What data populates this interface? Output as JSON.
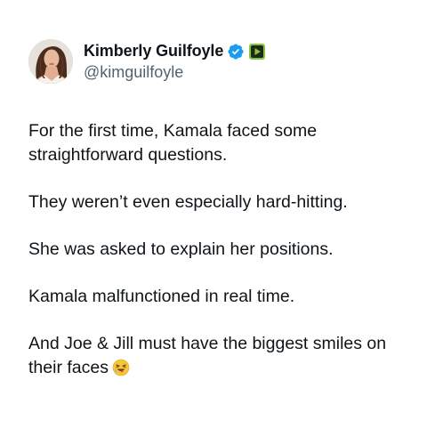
{
  "author": {
    "display_name": "Kimberly Guilfoyle",
    "handle": "@kimguilfoyle",
    "verified_icon": "verified-badge-icon",
    "extra_badge_icon": "rumble-play-icon",
    "verified_color": "#1d9bf0",
    "extra_badge_color": "#85c742"
  },
  "tweet": {
    "paragraphs": [
      "For the first time, Kamala faced some straightforward questions.",
      "They weren’t even especially hard-hitting.",
      "She was asked to explain her positions.",
      "Kamala malfunctioned in real time.",
      "And Joe & Jill must have the biggest smiles on their faces"
    ],
    "trailing_emoji": "face-with-tongue-laughing-emoji"
  }
}
